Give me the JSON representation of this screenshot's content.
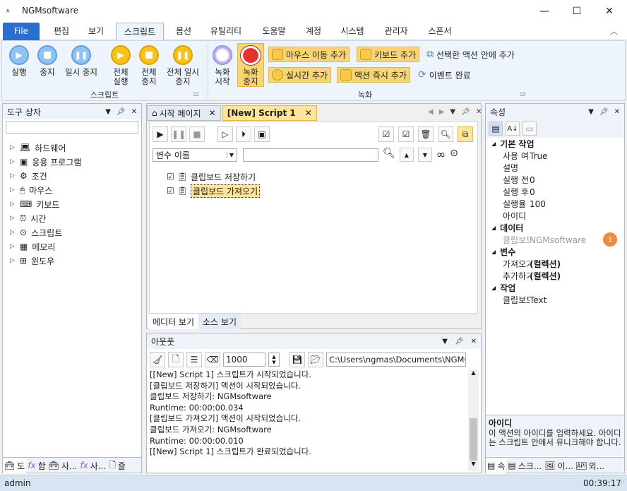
{
  "window": {
    "title": "NGMsoftware",
    "minimize": "—",
    "maximize": "☐",
    "close": "✕"
  },
  "menu": {
    "items": [
      "File",
      "편집",
      "보기",
      "스크립트",
      "옵션",
      "유틸리티",
      "도움말",
      "계정",
      "시스템",
      "관리자",
      "스폰서"
    ]
  },
  "ribbon": {
    "run": "실행",
    "stop": "중지",
    "pause": "일시 중지",
    "run_all": "전체 실행",
    "stop_all": "전체 중지",
    "pause_all": "전체 일시 중지",
    "group_script": "스크립트",
    "rec_start": "녹화 시작",
    "rec_stop": "녹화 중지",
    "mouse_move": "마우스 이동 추가",
    "keyboard": "키보드 추가",
    "in_action": "선택한 액션 안에 추가",
    "realtime": "실시간 추가",
    "action_now": "액션 즉시 추가",
    "event_done": "이벤트 완료",
    "group_record": "녹화"
  },
  "toolbox": {
    "title": "도구 상자",
    "items": [
      "하드웨어",
      "응용 프로그램",
      "조건",
      "마우스",
      "키보드",
      "시간",
      "스크립트",
      "메모리",
      "윈도우"
    ],
    "bottom_tabs": [
      "도",
      "함",
      "사...",
      "사...",
      "즐"
    ]
  },
  "editor": {
    "tab_start": "시작 페이지",
    "tab_script": "[New] Script 1",
    "var_select": "변수 이름",
    "actions": [
      {
        "label": "클립보드 저장하기",
        "checked": true
      },
      {
        "label": "클립보드 가져오기",
        "checked": true
      }
    ],
    "tab_editor": "에디터 보기",
    "tab_source": "소스 보기"
  },
  "output": {
    "title": "아웃풋",
    "count": "1000",
    "path": "C:\\Users\\ngmas\\Documents\\NGM6\\",
    "lines": [
      "[[New] Script 1] 스크립트가 시작되었습니다.",
      "[클립보드 저장하기] 액션이 시작되었습니다.",
      "클립보드 저장하기: NGMsoftware",
      "Runtime: 00:00:00.034",
      "[클립보드 가져오기] 액션이 시작되었습니다.",
      "클립보드 가져오기: NGMsoftware",
      "Runtime: 00:00:00.010",
      "[[New] Script 1] 스크립트가 완료되었습니다."
    ]
  },
  "props": {
    "title": "속성",
    "sec_basic": "기본 작업",
    "use": "사용 여부",
    "use_v": "True",
    "desc": "설명",
    "before": "실행 전 지",
    "before_v": "0",
    "after": "실행 후 지",
    "after_v": "0",
    "rate": "실행율",
    "rate_v": "100",
    "id": "아이디",
    "sec_data": "데이터",
    "clip": "클립보드 :",
    "clip_v": "NGMsoftware",
    "badge": "1",
    "sec_var": "변수",
    "get": "가져오기",
    "get_v": "(컬렉션)",
    "add": "추가하기",
    "add_v": "(컬렉션)",
    "sec_task": "작업",
    "clip2": "클립보드 [",
    "clip2_v": "Text",
    "help_title": "아이디",
    "help_text": "이 액션의 아이디를 입력하세요. 아이디는 스크립트 안에서 유니크해야 합니다.",
    "bottom_tabs": [
      "속",
      "스크...",
      "이...",
      "외..."
    ]
  },
  "status": {
    "user": "admin",
    "time": "00:39:17"
  }
}
